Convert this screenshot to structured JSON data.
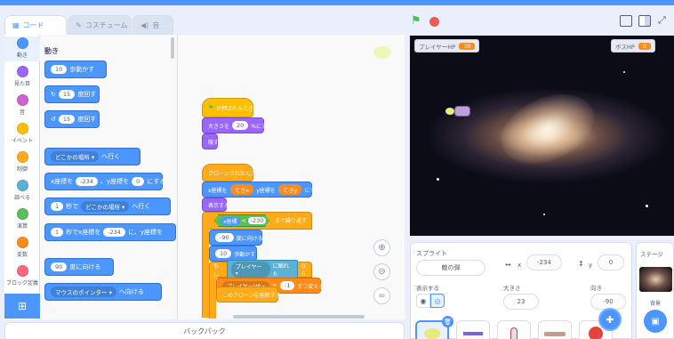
{
  "tabs": {
    "code": "コード",
    "costumes": "コスチューム",
    "sounds": "音"
  },
  "categories": [
    {
      "label": "動き",
      "color": "#4c97ff"
    },
    {
      "label": "見た目",
      "color": "#9966ff"
    },
    {
      "label": "音",
      "color": "#cf63cf"
    },
    {
      "label": "イベント",
      "color": "#ffbf00"
    },
    {
      "label": "制御",
      "color": "#ffab19"
    },
    {
      "label": "調べる",
      "color": "#5cb1d6"
    },
    {
      "label": "演算",
      "color": "#59c059"
    },
    {
      "label": "変数",
      "color": "#ff8c1a"
    },
    {
      "label": "ブロック定義",
      "color": "#ff6680"
    }
  ],
  "palette": {
    "heading": "動き",
    "move": {
      "num": "10",
      "text": "歩動かす"
    },
    "turn_right": {
      "num": "15",
      "text": "度回す"
    },
    "turn_left": {
      "num": "15",
      "text": "度回す"
    },
    "goto": {
      "drop": "どこかの場所 ▾",
      "text": "へ行く"
    },
    "gotoxy": {
      "pre": "x座標を",
      "x": "-234",
      "mid": "、y座標を",
      "y": "0",
      "post": "にする"
    },
    "glide": {
      "num": "1",
      "mid": "秒で",
      "drop": "どこかの場所 ▾",
      "post": "へ行く"
    },
    "glidexy": {
      "num": "1",
      "mid": "秒でx座標を",
      "x": "-234",
      "post": "に、y座標を"
    },
    "point": {
      "num": "90",
      "text": "度に向ける"
    },
    "pointto": {
      "drop": "マウスのポインター ▾",
      "text": "へ向ける"
    }
  },
  "script": {
    "flag_hat": "が押されたとき",
    "set_size": {
      "pre": "大きさを",
      "num": "20",
      "post": "%にする"
    },
    "hide": "隠す",
    "clone_hat": "クローンされたとき",
    "gotoxy": {
      "pre": "x座標を",
      "x": "てきx",
      "mid": "y座標を",
      "y": "てきy",
      "post": "にする"
    },
    "show": "表示する",
    "repeat_until": {
      "a": "x座標",
      "op": "<",
      "b": "-230",
      "post": "まで繰り返す"
    },
    "point": {
      "num": "-90",
      "text": "度に向ける"
    },
    "move": {
      "num": "10",
      "text": "歩動かす"
    },
    "if_touch": {
      "pre": "もし",
      "drop": "プレイヤー ▾",
      "mid": "に触れた",
      "post": "なら"
    },
    "change_var": {
      "drop": "プレイヤーHP ▾",
      "mid": "を",
      "num": "-1",
      "post": "ずつ変える"
    },
    "delete_clone": "このクローンを削除する"
  },
  "backpack": "バックパック",
  "stage": {
    "monitor1": {
      "label": "プレイヤーHP",
      "value": "30"
    },
    "monitor2": {
      "label": "ボスHP",
      "value": "0"
    }
  },
  "sprite_info": {
    "sprite_label": "スプライト",
    "sprite_name": "敵の弾",
    "x_label": "x",
    "x_value": "-234",
    "y_label": "y",
    "y_value": "0",
    "show_label": "表示する",
    "size_label": "大きさ",
    "size_value": "23",
    "direction_label": "向き",
    "direction_value": "-90"
  },
  "stage_panel": {
    "label": "ステージ",
    "backdrop_label": "背景"
  }
}
